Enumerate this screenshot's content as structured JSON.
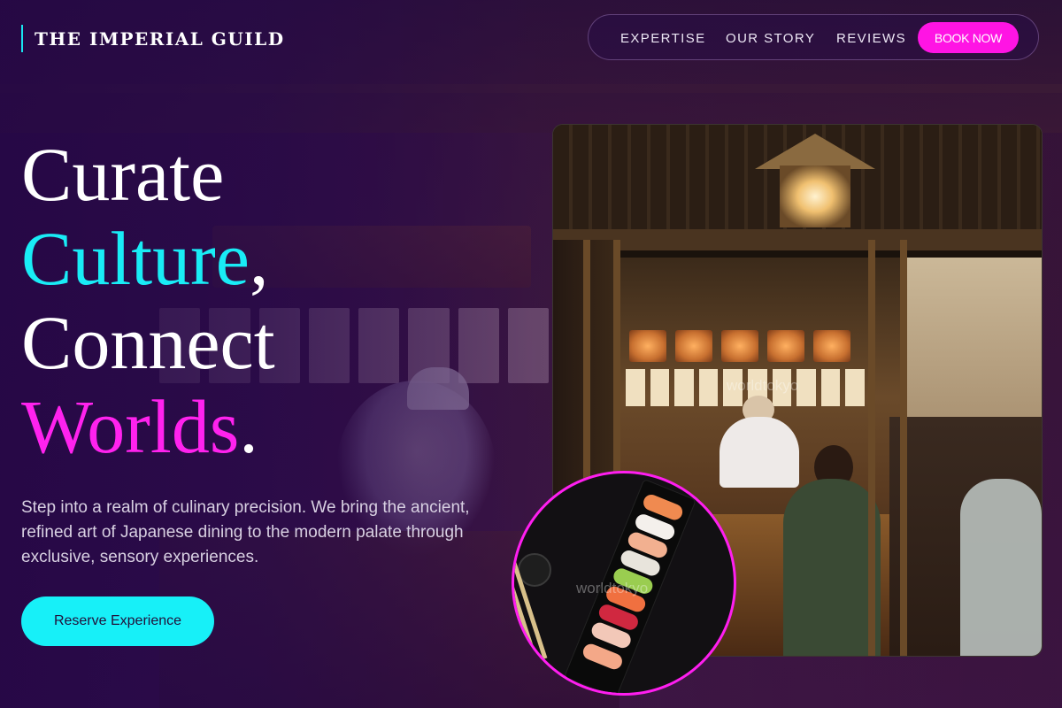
{
  "header": {
    "logo_text": "THE IMPERIAL GUILD",
    "nav": [
      {
        "label": "EXPERTISE"
      },
      {
        "label": "OUR STORY"
      },
      {
        "label": "REVIEWS"
      }
    ],
    "book_button": "BOOK NOW"
  },
  "hero": {
    "line1": "Curate",
    "line2_word": "Culture",
    "line2_punct": ",",
    "line3": "Connect",
    "line4_word": "Worlds",
    "line4_punct": ".",
    "description": "Step into a realm of culinary precision. We bring the ancient, refined art of Japanese dining to the modern palate through exclusive, sensory experiences.",
    "cta_label": "Reserve Experience"
  },
  "media": {
    "watermark": "worldtokyo"
  },
  "colors": {
    "accent_cyan": "#19ecf6",
    "accent_magenta": "#ff22ee",
    "background": "#2a0c3a",
    "book_button": "#ff14e4"
  },
  "icons": {
    "main_photo": "restaurant-photo",
    "sushi_photo": "sushi-photo"
  }
}
